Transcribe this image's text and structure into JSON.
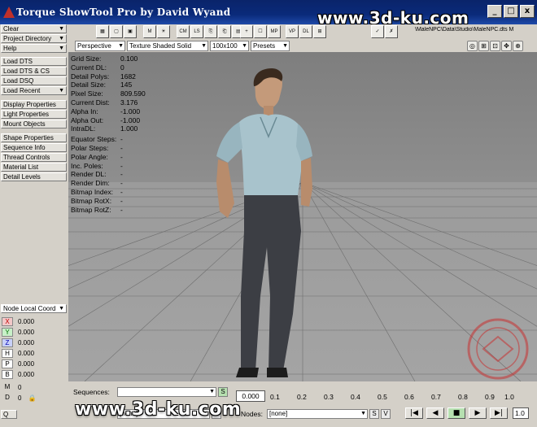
{
  "window": {
    "title": "Torque ShowTool Pro by David Wyand",
    "buttons": [
      "_",
      "□",
      "x"
    ]
  },
  "left_panel": {
    "top_buttons": [
      {
        "label": "Clear",
        "dropdown": true
      },
      {
        "label": "Project Directory",
        "dropdown": true
      },
      {
        "label": "Help",
        "dropdown": true
      }
    ],
    "load_buttons": [
      {
        "label": "Load DTS",
        "dropdown": false
      },
      {
        "label": "Load DTS & CS",
        "dropdown": false
      },
      {
        "label": "Load DSQ",
        "dropdown": false
      },
      {
        "label": "Load Recent",
        "dropdown": true
      }
    ],
    "property_buttons": [
      "Display Properties",
      "Light Properties",
      "Mount Objects"
    ],
    "shape_buttons": [
      "Shape Properties",
      "Sequence Info",
      "Thread Controls",
      "Material List",
      "Detail Levels"
    ],
    "coord_mode": "Node Local Coord",
    "coords": [
      {
        "axis": "X",
        "value": "0.000"
      },
      {
        "axis": "Y",
        "value": "0.000"
      },
      {
        "axis": "Z",
        "value": "0.000"
      },
      {
        "axis": "H",
        "value": "0.000"
      },
      {
        "axis": "P",
        "value": "0.000"
      },
      {
        "axis": "B",
        "value": "0.000"
      },
      {
        "axis": "M",
        "value": "0"
      },
      {
        "axis": "D",
        "value": "0"
      }
    ]
  },
  "toolbar": {
    "icons": [
      "grid-icon",
      "frame-icon",
      "view-icon",
      "mesh-icon",
      "light-icon",
      "cm-icon",
      "ls-icon",
      "copy-icon",
      "paste-icon",
      "tex-icon",
      "plus-icon",
      "bag-icon",
      "mp-icon",
      "vp-icon",
      "dl-icon",
      "node-icon",
      "check-icon",
      "x-icon"
    ],
    "icon_labels": [
      "▦",
      "▢",
      "▣",
      "M",
      "☀",
      "CM",
      "LS",
      "⎘",
      "⎗",
      "▤",
      "+",
      "☐",
      "MP",
      "VP",
      "DL",
      "⊞",
      "✓",
      "✗"
    ],
    "path_text": "\\MaleNPC\\Data\\Studio\\MaleNPC.dts M"
  },
  "viewbar": {
    "camera": "Perspective",
    "render_mode": "Texture Shaded Solid",
    "grid_size": "100x100",
    "presets": "Presets",
    "nav_icons": [
      "◎",
      "⊞",
      "⊡",
      "✥",
      "⊕"
    ]
  },
  "stats": [
    {
      "label": "Grid Size:",
      "value": "0.100"
    },
    {
      "label": "Current DL:",
      "value": "0"
    },
    {
      "label": "Detail Polys:",
      "value": "1682"
    },
    {
      "label": "Detail Size:",
      "value": "145"
    },
    {
      "label": "Pixel Size:",
      "value": "809.590"
    },
    {
      "label": "Current Dist:",
      "value": "3.176"
    },
    {
      "label": "Alpha In:",
      "value": "-1.000"
    },
    {
      "label": "Alpha Out:",
      "value": "-1.000"
    },
    {
      "label": "IntraDL:",
      "value": "1.000"
    },
    {
      "label": "Equator Steps:",
      "value": "-"
    },
    {
      "label": "Polar Steps:",
      "value": "-"
    },
    {
      "label": "Polar Angle:",
      "value": "-"
    },
    {
      "label": "Inc. Poles:",
      "value": "-"
    },
    {
      "label": "Render DL:",
      "value": "-"
    },
    {
      "label": "Render Dim:",
      "value": "-"
    },
    {
      "label": "Bitmap Index:",
      "value": "-"
    },
    {
      "label": "Bitmap RotX:",
      "value": "-"
    },
    {
      "label": "Bitmap RotZ:",
      "value": "-"
    }
  ],
  "timeline": {
    "sequences_label": "Sequences:",
    "sequence_value": "",
    "s_button": "S",
    "current_time": "0.000",
    "ticks": [
      "0.1",
      "0.2",
      "0.3",
      "0.4",
      "0.5",
      "0.6",
      "0.7",
      "0.8",
      "0.9",
      "1.0"
    ],
    "nodes_label": "Nodes:",
    "nodes_value": "[none]",
    "left_select_value": "[none]",
    "playback_buttons": [
      "|◀",
      "◀",
      "■",
      "▶",
      "▶|"
    ],
    "speed": "1.0"
  },
  "watermarks": {
    "top": "www.3d-ku.com",
    "bottom": "www.3d-ku.com"
  },
  "colors": {
    "title_bar": "#0a246a",
    "viewport_sky": "#8a8a8a",
    "grid_floor": "#9a9a9a",
    "panel": "#d4d0c8"
  }
}
